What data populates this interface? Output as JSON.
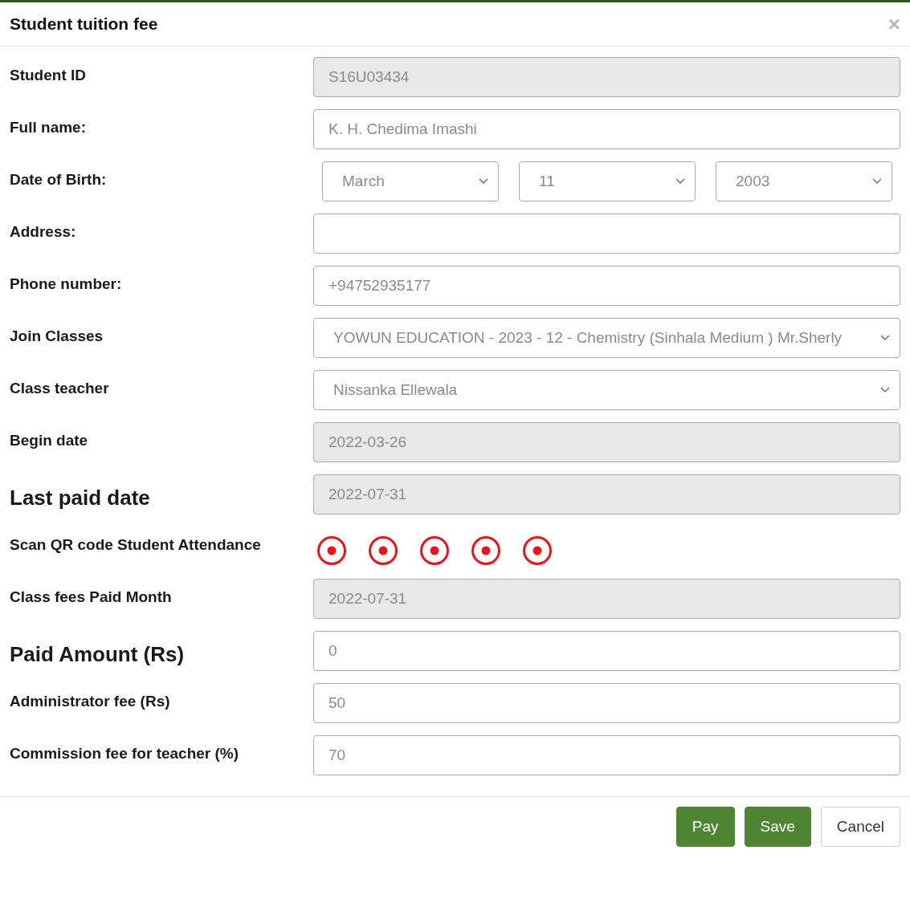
{
  "dialog": {
    "title": "Student tuition fee",
    "close": "×"
  },
  "fields": [
    {
      "label": "Student ID",
      "emphasized": false,
      "kind": "text",
      "value": "S16U03434",
      "disabled": true
    },
    {
      "label": "Full name:",
      "emphasized": false,
      "kind": "text",
      "value": "K. H. Chedima Imashi",
      "disabled": false
    },
    {
      "label": "Date of Birth:",
      "emphasized": false,
      "kind": "selects",
      "values": [
        "March",
        "11",
        "2003"
      ]
    },
    {
      "label": "Address:",
      "emphasized": false,
      "kind": "text",
      "disabled": false
    },
    {
      "label": "Phone number:",
      "emphasized": false,
      "kind": "text",
      "value": "+94752935177",
      "disabled": false
    },
    {
      "label": "Join Classes",
      "emphasized": false,
      "kind": "select",
      "value": "YOWUN EDUCATION - 2023 - 12 - Chemistry (Sinhala Medium ) Mr.Sherly"
    },
    {
      "label": "Class teacher",
      "emphasized": false,
      "kind": "select",
      "value": "Nissanka Ellewala"
    },
    {
      "label": "Begin date",
      "emphasized": false,
      "kind": "text",
      "value": "2022-03-26",
      "disabled": true
    },
    {
      "label": "Last paid date",
      "emphasized": true,
      "kind": "text",
      "value": "2022-07-31",
      "disabled": true
    },
    {
      "label": "Scan QR code Student Attendance",
      "emphasized": false,
      "kind": "radios",
      "radios": [
        {
          "checked": true
        },
        {
          "checked": true
        },
        {
          "checked": true
        },
        {
          "checked": true
        },
        {
          "checked": true
        }
      ]
    },
    {
      "label": "Class fees Paid Month",
      "emphasized": false,
      "kind": "text",
      "value": "2022-07-31",
      "disabled": true
    },
    {
      "label": "Paid Amount (Rs)",
      "emphasized": true,
      "kind": "text",
      "value": "0",
      "disabled": false
    },
    {
      "label": "Administrator fee (Rs)",
      "emphasized": false,
      "kind": "text",
      "value": "50",
      "disabled": false
    },
    {
      "label": "Commission fee for teacher (%)",
      "emphasized": false,
      "kind": "text",
      "value": "70",
      "disabled": false
    }
  ],
  "buttons": [
    {
      "label": "Pay",
      "kind": "primary"
    },
    {
      "label": "Save",
      "kind": "primary"
    },
    {
      "label": "Cancel",
      "kind": "default"
    }
  ]
}
